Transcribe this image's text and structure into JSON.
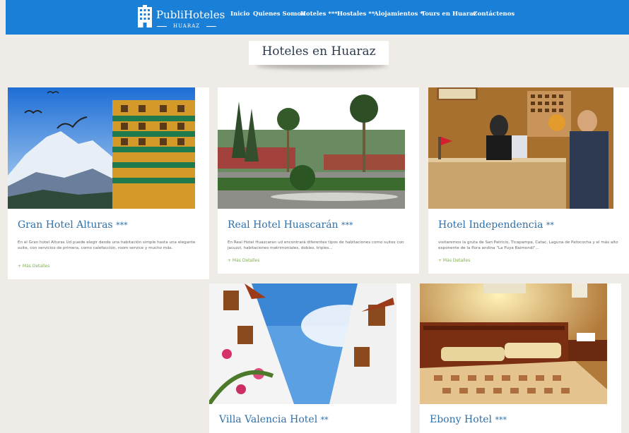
{
  "header": {
    "logo_text": "PubliHoteles",
    "logo_sub": "HUARAZ",
    "nav": [
      {
        "label": "Inicio"
      },
      {
        "label": "Quienes Somos"
      },
      {
        "label": "Hoteles ***"
      },
      {
        "label": "Hostales **"
      },
      {
        "label": "Alojamientos *"
      },
      {
        "label": "Tours en Huaraz"
      },
      {
        "label": "Contáctenos"
      }
    ]
  },
  "page": {
    "title": "Hoteles en Huaraz"
  },
  "hotels": [
    {
      "name": "Gran Hotel Alturas",
      "stars": "***",
      "description": "En el Gran hotel Alturas Ud puede elegir desde una habitación simple hasta una elegante suite, con servicios de primera, como calefacción, room service y mucho más.",
      "link": "+ Más Detalles"
    },
    {
      "name": "Real Hotel Huascarán",
      "stars": "***",
      "description": "En Real Hotel Huascaran ud encontrará diferentes tipos de habitaciones como suites con jacuzzi, habitaciones matrimoniales, dobles, triples...",
      "link": "+ Más Detalles"
    },
    {
      "name": "Hotel Independencia",
      "stars": "**",
      "description": "visitaremos la gruta de San Patricio, Ticapampa, Catac, Laguna de Patococha y el más alto exponente de la flora andina \"La Puya Raimondi\"...",
      "link": "+ Más Detalles"
    },
    {
      "name": "Villa Valencia Hotel",
      "stars": "**"
    },
    {
      "name": "Ebony Hotel",
      "stars": "***"
    }
  ],
  "colors": {
    "nav_bg": "#1a7fd6",
    "link_green": "#7fae4a",
    "title_blue": "#3170a6"
  }
}
